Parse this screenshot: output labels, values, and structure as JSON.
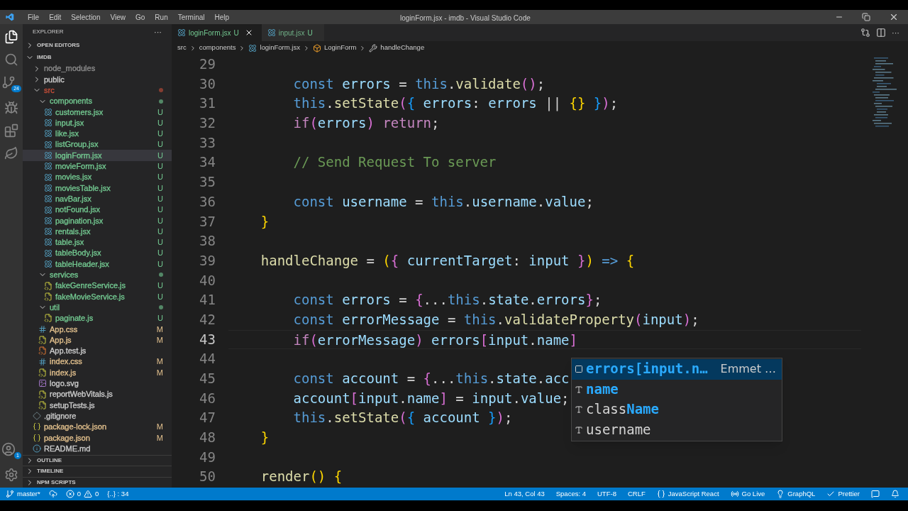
{
  "window": {
    "title": "loginForm.jsx - imdb - Visual Studio Code"
  },
  "menu": [
    "File",
    "Edit",
    "Selection",
    "View",
    "Go",
    "Run",
    "Terminal",
    "Help"
  ],
  "activity_bar": {
    "source_control_badge": "24",
    "accounts_badge": "1"
  },
  "sidebar": {
    "title": "EXPLORER",
    "more": "···",
    "open_editors": "OPEN EDITORS",
    "root": "IMDB",
    "tree": [
      {
        "kind": "folder",
        "name": "node_modules",
        "expanded": false,
        "color": "#8c8c8c",
        "selected": false
      },
      {
        "kind": "folder",
        "name": "public",
        "expanded": false,
        "color": "#cccccc",
        "selected": false
      },
      {
        "kind": "folder",
        "name": "src",
        "expanded": true,
        "color": "#c74e39",
        "dot": true,
        "selected": false,
        "children": [
          {
            "kind": "folder",
            "name": "components",
            "expanded": true,
            "color": "#73c991",
            "dot": true,
            "selected": false,
            "children": [
              {
                "kind": "react",
                "name": "customers.jsx",
                "color": "#73c991",
                "badge": "U",
                "selected": false
              },
              {
                "kind": "react",
                "name": "input.jsx",
                "color": "#73c991",
                "badge": "U",
                "selected": false
              },
              {
                "kind": "react",
                "name": "like.jsx",
                "color": "#73c991",
                "badge": "U",
                "selected": false
              },
              {
                "kind": "react",
                "name": "listGroup.jsx",
                "color": "#73c991",
                "badge": "U",
                "selected": false
              },
              {
                "kind": "react",
                "name": "loginForm.jsx",
                "color": "#73c991",
                "badge": "U",
                "selected": true
              },
              {
                "kind": "react",
                "name": "movieForm.jsx",
                "color": "#73c991",
                "badge": "U",
                "selected": false
              },
              {
                "kind": "react",
                "name": "movies.jsx",
                "color": "#73c991",
                "badge": "U",
                "selected": false
              },
              {
                "kind": "react",
                "name": "moviesTable.jsx",
                "color": "#73c991",
                "badge": "U",
                "selected": false
              },
              {
                "kind": "react",
                "name": "navBar.jsx",
                "color": "#73c991",
                "badge": "U",
                "selected": false
              },
              {
                "kind": "react",
                "name": "notFound.jsx",
                "color": "#73c991",
                "badge": "U",
                "selected": false
              },
              {
                "kind": "react",
                "name": "pagination.jsx",
                "color": "#73c991",
                "badge": "U",
                "selected": false
              },
              {
                "kind": "react",
                "name": "rentals.jsx",
                "color": "#73c991",
                "badge": "U",
                "selected": false
              },
              {
                "kind": "react",
                "name": "table.jsx",
                "color": "#73c991",
                "badge": "U",
                "selected": false
              },
              {
                "kind": "react",
                "name": "tableBody.jsx",
                "color": "#73c991",
                "badge": "U",
                "selected": false
              },
              {
                "kind": "react",
                "name": "tableHeader.jsx",
                "color": "#73c991",
                "badge": "U",
                "selected": false
              }
            ]
          },
          {
            "kind": "folder",
            "name": "services",
            "expanded": true,
            "color": "#73c991",
            "dot": true,
            "selected": false,
            "children": [
              {
                "kind": "js",
                "name": "fakeGenreService.js",
                "color": "#73c991",
                "badge": "U",
                "selected": false
              },
              {
                "kind": "js",
                "name": "fakeMovieService.js",
                "color": "#73c991",
                "badge": "U",
                "selected": false
              }
            ]
          },
          {
            "kind": "folder",
            "name": "util",
            "expanded": true,
            "color": "#73c991",
            "dot": true,
            "selected": false,
            "children": [
              {
                "kind": "js",
                "name": "paginate.js",
                "color": "#73c991",
                "badge": "U",
                "selected": false
              }
            ]
          },
          {
            "kind": "css",
            "name": "App.css",
            "color": "#e2c08d",
            "badge": "M",
            "selected": false
          },
          {
            "kind": "js",
            "name": "App.js",
            "color": "#e2c08d",
            "badge": "M",
            "selected": false
          },
          {
            "kind": "test",
            "name": "App.test.js",
            "color": "#cccccc",
            "selected": false
          },
          {
            "kind": "css",
            "name": "index.css",
            "color": "#e2c08d",
            "badge": "M",
            "selected": false
          },
          {
            "kind": "js",
            "name": "index.js",
            "color": "#e2c08d",
            "badge": "M",
            "selected": false
          },
          {
            "kind": "svg",
            "name": "logo.svg",
            "color": "#cccccc",
            "selected": false
          },
          {
            "kind": "js",
            "name": "reportWebVitals.js",
            "color": "#cccccc",
            "selected": false
          },
          {
            "kind": "js",
            "name": "setupTests.js",
            "color": "#cccccc",
            "selected": false
          }
        ]
      },
      {
        "kind": "git",
        "name": ".gitignore",
        "color": "#cccccc",
        "selected": false
      },
      {
        "kind": "json",
        "name": "package-lock.json",
        "color": "#e2c08d",
        "badge": "M",
        "selected": false
      },
      {
        "kind": "json",
        "name": "package.json",
        "color": "#e2c08d",
        "badge": "M",
        "selected": false
      },
      {
        "kind": "info",
        "name": "README.md",
        "color": "#cccccc",
        "selected": false
      }
    ],
    "sections": [
      "OUTLINE",
      "TIMELINE",
      "NPM SCRIPTS"
    ]
  },
  "tabs": [
    {
      "label": "loginForm.jsx",
      "badge": "U",
      "selected": true
    },
    {
      "label": "input.jsx",
      "badge": "U",
      "selected": false
    }
  ],
  "editor_actions": {
    "more": "···"
  },
  "breadcrumbs": [
    {
      "kind": "folder",
      "label": "src"
    },
    {
      "kind": "folder",
      "label": "components"
    },
    {
      "kind": "react",
      "label": "loginForm.jsx"
    },
    {
      "kind": "class",
      "label": "LoginForm"
    },
    {
      "kind": "method",
      "label": "handleChange"
    }
  ],
  "editor": {
    "lines": [
      {
        "number": "29",
        "current": false
      },
      {
        "number": "30",
        "current": false,
        "tokens": [
          {
            "text": "        const ",
            "kind": "kw"
          },
          {
            "text": "errors",
            "kind": "var"
          },
          {
            "text": " = ",
            "kind": "p"
          },
          {
            "text": "this",
            "kind": "kw"
          },
          {
            "text": ".",
            "kind": "p"
          },
          {
            "text": "validate",
            "kind": "fn"
          },
          {
            "text": "()",
            "kind": "b2"
          },
          {
            "text": ";",
            "kind": "p"
          }
        ]
      },
      {
        "number": "31",
        "current": false,
        "tokens": [
          {
            "text": "        this",
            "kind": "kw"
          },
          {
            "text": ".",
            "kind": "p"
          },
          {
            "text": "setState",
            "kind": "fn"
          },
          {
            "text": "(",
            "kind": "b2"
          },
          {
            "text": "{",
            "kind": "b3"
          },
          {
            "text": " errors",
            "kind": "var"
          },
          {
            "text": ": ",
            "kind": "p"
          },
          {
            "text": "errors",
            "kind": "var"
          },
          {
            "text": " || ",
            "kind": "p"
          },
          {
            "text": "{}",
            "kind": "b1"
          },
          {
            "text": " }",
            "kind": "b3"
          },
          {
            "text": ")",
            "kind": "b2"
          },
          {
            "text": ";",
            "kind": "p"
          }
        ]
      },
      {
        "number": "32",
        "current": false,
        "tokens": [
          {
            "text": "        if",
            "kind": "ctl"
          },
          {
            "text": "(",
            "kind": "b2"
          },
          {
            "text": "errors",
            "kind": "var"
          },
          {
            "text": ")",
            "kind": "b2"
          },
          {
            "text": " return",
            "kind": "ctl"
          },
          {
            "text": ";",
            "kind": "p"
          }
        ]
      },
      {
        "number": "33",
        "current": false
      },
      {
        "number": "34",
        "current": false,
        "tokens": [
          {
            "text": "        // Send Request To server",
            "kind": "cm"
          }
        ]
      },
      {
        "number": "35",
        "current": false
      },
      {
        "number": "36",
        "current": false,
        "tokens": [
          {
            "text": "        const ",
            "kind": "kw"
          },
          {
            "text": "username",
            "kind": "var"
          },
          {
            "text": " = ",
            "kind": "p"
          },
          {
            "text": "this",
            "kind": "kw"
          },
          {
            "text": ".",
            "kind": "p"
          },
          {
            "text": "username",
            "kind": "var"
          },
          {
            "text": ".",
            "kind": "p"
          },
          {
            "text": "value",
            "kind": "var"
          },
          {
            "text": ";",
            "kind": "p"
          }
        ]
      },
      {
        "number": "37",
        "current": false,
        "tokens": [
          {
            "text": "    }",
            "kind": "b1"
          }
        ]
      },
      {
        "number": "38",
        "current": false
      },
      {
        "number": "39",
        "current": false,
        "tokens": [
          {
            "text": "    handleChange",
            "kind": "fn"
          },
          {
            "text": " = ",
            "kind": "p"
          },
          {
            "text": "(",
            "kind": "b1"
          },
          {
            "text": "{",
            "kind": "b2"
          },
          {
            "text": " currentTarget",
            "kind": "var"
          },
          {
            "text": ": ",
            "kind": "p"
          },
          {
            "text": "input",
            "kind": "var"
          },
          {
            "text": " }",
            "kind": "b2"
          },
          {
            "text": ")",
            "kind": "b1"
          },
          {
            "text": " =>",
            "kind": "kw"
          },
          {
            "text": " {",
            "kind": "b1"
          }
        ]
      },
      {
        "number": "40",
        "current": false
      },
      {
        "number": "41",
        "current": false,
        "tokens": [
          {
            "text": "        const ",
            "kind": "kw"
          },
          {
            "text": "errors",
            "kind": "var"
          },
          {
            "text": " = ",
            "kind": "p"
          },
          {
            "text": "{",
            "kind": "b2"
          },
          {
            "text": "...",
            "kind": "p"
          },
          {
            "text": "this",
            "kind": "kw"
          },
          {
            "text": ".",
            "kind": "p"
          },
          {
            "text": "state",
            "kind": "var"
          },
          {
            "text": ".",
            "kind": "p"
          },
          {
            "text": "errors",
            "kind": "var"
          },
          {
            "text": "}",
            "kind": "b2"
          },
          {
            "text": ";",
            "kind": "p"
          }
        ]
      },
      {
        "number": "42",
        "current": false,
        "tokens": [
          {
            "text": "        const ",
            "kind": "kw"
          },
          {
            "text": "errorMessage",
            "kind": "var"
          },
          {
            "text": " = ",
            "kind": "p"
          },
          {
            "text": "this",
            "kind": "kw"
          },
          {
            "text": ".",
            "kind": "p"
          },
          {
            "text": "validateProperty",
            "kind": "fn"
          },
          {
            "text": "(",
            "kind": "b2"
          },
          {
            "text": "input",
            "kind": "var"
          },
          {
            "text": ")",
            "kind": "b2"
          },
          {
            "text": ";",
            "kind": "p"
          }
        ]
      },
      {
        "number": "43",
        "current": true,
        "tokens": [
          {
            "text": "        if",
            "kind": "ctl"
          },
          {
            "text": "(",
            "kind": "b2"
          },
          {
            "text": "errorMessage",
            "kind": "var"
          },
          {
            "text": ")",
            "kind": "b2"
          },
          {
            "text": " errors",
            "kind": "var"
          },
          {
            "text": "[",
            "kind": "b2"
          },
          {
            "text": "input",
            "kind": "var"
          },
          {
            "text": ".",
            "kind": "p"
          },
          {
            "text": "name",
            "kind": "var"
          },
          {
            "text": "]",
            "kind": "b2"
          }
        ]
      },
      {
        "number": "44",
        "current": false
      },
      {
        "number": "45",
        "current": false,
        "tokens": [
          {
            "text": "        const ",
            "kind": "kw"
          },
          {
            "text": "account",
            "kind": "var"
          },
          {
            "text": " = ",
            "kind": "p"
          },
          {
            "text": "{",
            "kind": "b2"
          },
          {
            "text": "...",
            "kind": "p"
          },
          {
            "text": "this",
            "kind": "kw"
          },
          {
            "text": ".",
            "kind": "p"
          },
          {
            "text": "state",
            "kind": "var"
          },
          {
            "text": ".",
            "kind": "p"
          },
          {
            "text": "acc",
            "kind": "var"
          }
        ]
      },
      {
        "number": "46",
        "current": false,
        "tokens": [
          {
            "text": "        account",
            "kind": "var"
          },
          {
            "text": "[",
            "kind": "b2"
          },
          {
            "text": "input",
            "kind": "var"
          },
          {
            "text": ".",
            "kind": "p"
          },
          {
            "text": "name",
            "kind": "var"
          },
          {
            "text": "]",
            "kind": "b2"
          },
          {
            "text": " = ",
            "kind": "p"
          },
          {
            "text": "input",
            "kind": "var"
          },
          {
            "text": ".",
            "kind": "p"
          },
          {
            "text": "value",
            "kind": "var"
          },
          {
            "text": ";",
            "kind": "p"
          }
        ]
      },
      {
        "number": "47",
        "current": false,
        "tokens": [
          {
            "text": "        this",
            "kind": "kw"
          },
          {
            "text": ".",
            "kind": "p"
          },
          {
            "text": "setState",
            "kind": "fn"
          },
          {
            "text": "(",
            "kind": "b2"
          },
          {
            "text": "{",
            "kind": "b3"
          },
          {
            "text": " account",
            "kind": "var"
          },
          {
            "text": " }",
            "kind": "b3"
          },
          {
            "text": ")",
            "kind": "b2"
          },
          {
            "text": ";",
            "kind": "p"
          }
        ]
      },
      {
        "number": "48",
        "current": false,
        "tokens": [
          {
            "text": "    }",
            "kind": "b1"
          }
        ]
      },
      {
        "number": "49",
        "current": false
      },
      {
        "number": "50",
        "current": false,
        "tokens": [
          {
            "text": "    render",
            "kind": "fn"
          },
          {
            "text": "()",
            "kind": "b1"
          },
          {
            "text": " {",
            "kind": "b1"
          }
        ]
      }
    ]
  },
  "suggestions": {
    "items": [
      {
        "kind": "snippet",
        "selected": true,
        "parts": [
          {
            "text": "errors[input.n…",
            "match": true
          }
        ],
        "detail": "Emmet …"
      },
      {
        "kind": "text",
        "selected": false,
        "parts": [
          {
            "text": "name",
            "match": true
          }
        ]
      },
      {
        "kind": "text",
        "selected": false,
        "parts": [
          {
            "text": "class",
            "match": false
          },
          {
            "text": "Name",
            "match": true
          }
        ]
      },
      {
        "kind": "text",
        "selected": false,
        "parts": [
          {
            "text": "username",
            "match": false
          }
        ]
      }
    ]
  },
  "status_bar": {
    "branch": "master*",
    "errors": "0",
    "warnings": "0",
    "extra": "{..} : 34",
    "right": [
      {
        "kind": "plain",
        "label": "Ln 43, Col 43"
      },
      {
        "kind": "plain",
        "label": "Spaces: 4"
      },
      {
        "kind": "plain",
        "label": "UTF-8"
      },
      {
        "kind": "plain",
        "label": "CRLF"
      },
      {
        "kind": "braces",
        "label": "JavaScript React"
      },
      {
        "kind": "live",
        "label": "Go Live"
      },
      {
        "kind": "bulb",
        "label": "GraphQL"
      },
      {
        "kind": "check",
        "label": "Prettier"
      },
      {
        "kind": "feedback"
      },
      {
        "kind": "bell"
      }
    ]
  }
}
